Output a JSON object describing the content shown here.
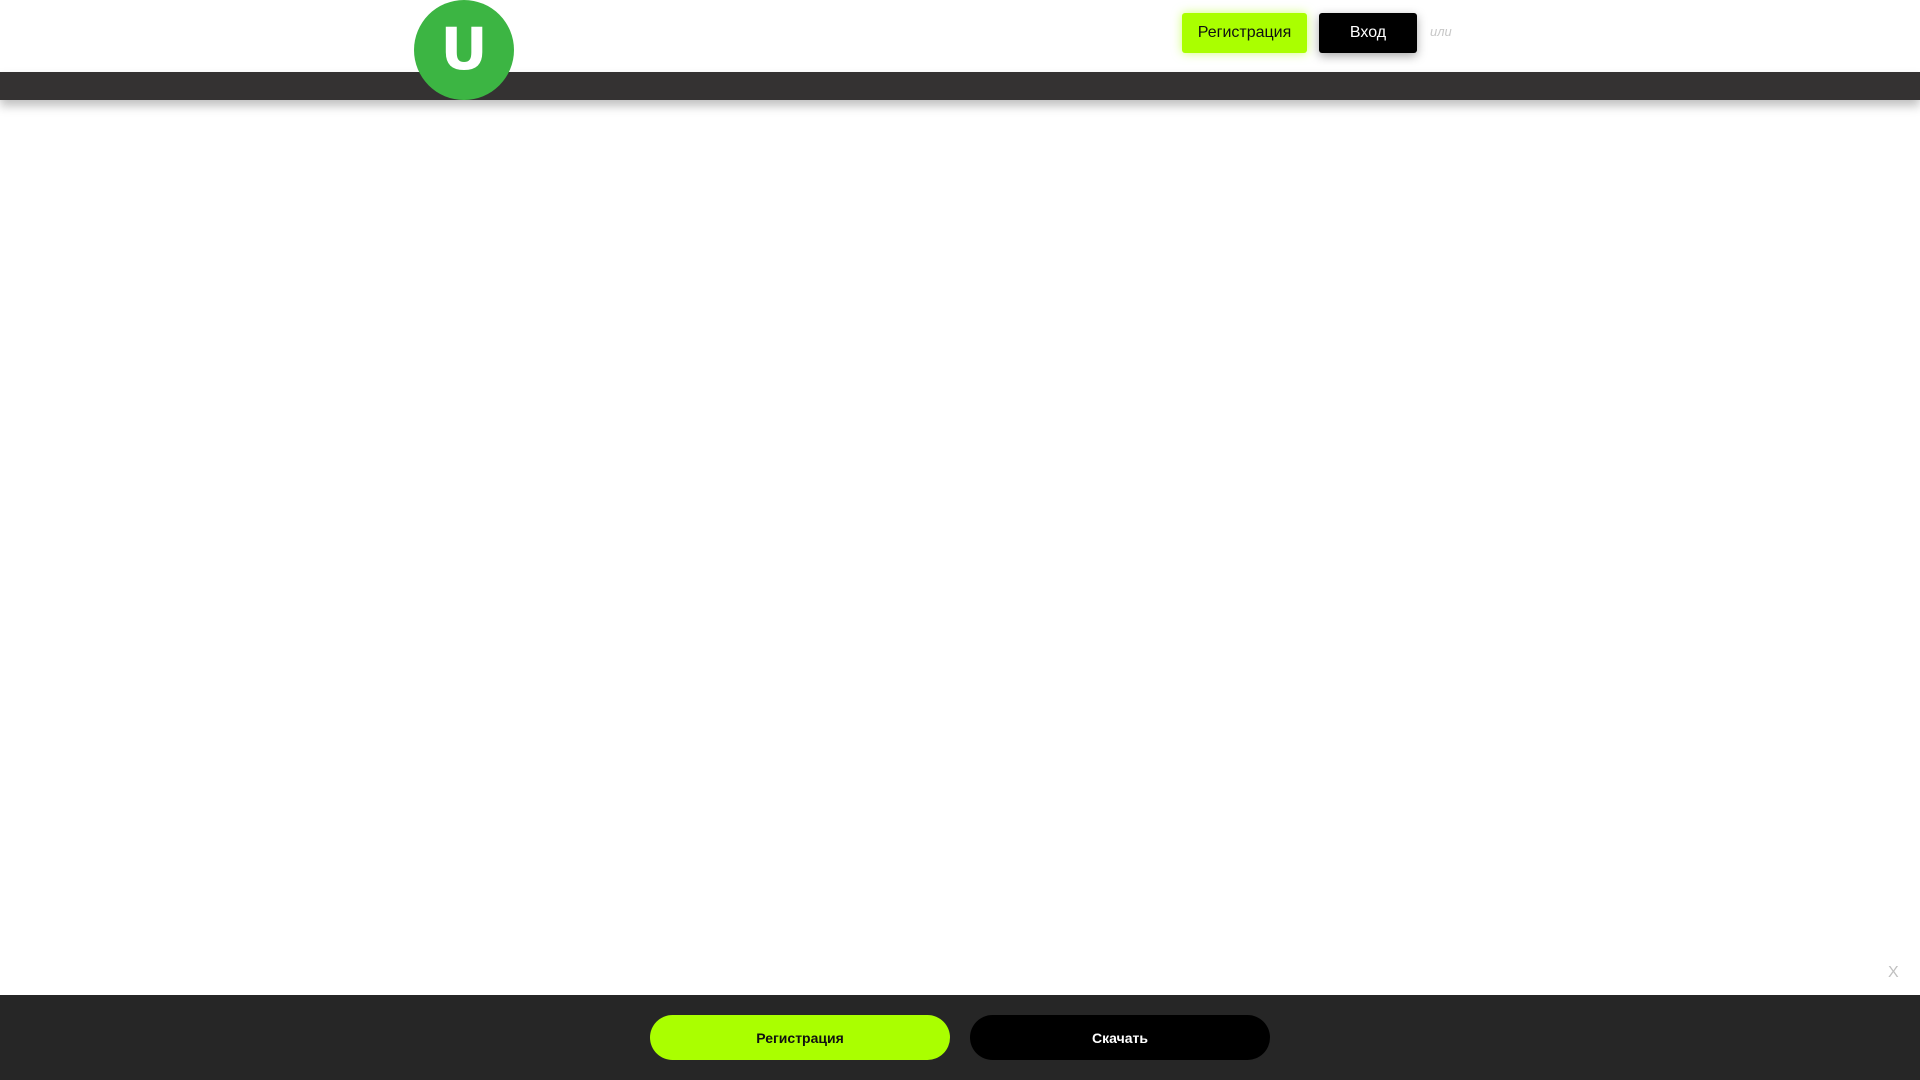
{
  "header": {
    "logo_letter": "U",
    "register_label": "Регистрация",
    "login_label": "Вход",
    "or_text": "или"
  },
  "popup": {
    "close_label": "X"
  },
  "bottom_bar": {
    "register_label": "Регистрация",
    "download_label": "Скачать"
  },
  "colors": {
    "brand_green": "#3cb543",
    "accent_lime": "#aaff00",
    "nav_strip": "#343232",
    "bottom_bar_bg": "#262626",
    "login_bg": "#000000"
  }
}
